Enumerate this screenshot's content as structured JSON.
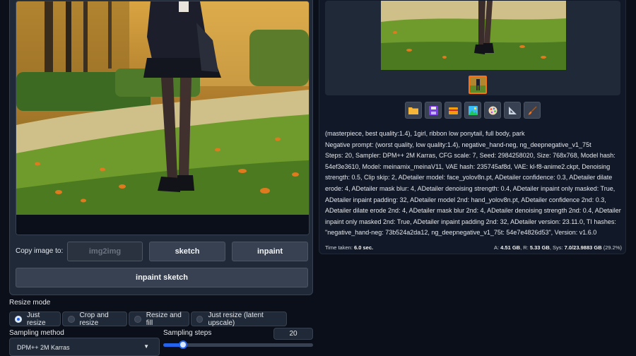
{
  "copy_image": {
    "label": "Copy image to:",
    "buttons": [
      {
        "label": "img2img"
      },
      {
        "label": "sketch"
      },
      {
        "label": "inpaint"
      }
    ]
  },
  "inpaint_sketch_label": "inpaint sketch",
  "resize_mode": {
    "label": "Resize mode",
    "options": [
      {
        "label": "Just resize",
        "checked": true
      },
      {
        "label": "Crop and resize"
      },
      {
        "label": "Resize and fill"
      },
      {
        "label": "Just resize (latent upscale)"
      }
    ]
  },
  "sampling_method": {
    "label": "Sampling method",
    "value": "DPM++ 2M Karras"
  },
  "sampling_steps": {
    "label": "Sampling steps",
    "value": "20",
    "fraction": 0.13
  },
  "toolbar": {
    "icons": [
      "folder-icon",
      "save-icon",
      "zip-icon",
      "send-to-img2img-icon",
      "palette-icon",
      "ruler-triangle-icon",
      "paintbrush-icon"
    ]
  },
  "generation_info": {
    "prompt": "(masterpiece, best quality:1.4), 1girl, ribbon low ponytail, full body, park",
    "negative": "Negative prompt: (worst quality, low quality:1.4), negative_hand-neg, ng_deepnegative_v1_75t",
    "params": "Steps: 20, Sampler: DPM++ 2M Karras, CFG scale: 7, Seed: 2984258020, Size: 768x768, Model hash: 54ef3e3610, Model: meinamix_meinaV11, VAE hash: 235745af8d, VAE: kl-f8-anime2.ckpt, Denoising strength: 0.5, Clip skip: 2, ADetailer model: face_yolov8n.pt, ADetailer confidence: 0.3, ADetailer dilate erode: 4, ADetailer mask blur: 4, ADetailer denoising strength: 0.4, ADetailer inpaint only masked: True, ADetailer inpaint padding: 32, ADetailer model 2nd: hand_yolov8n.pt, ADetailer confidence 2nd: 0.3, ADetailer dilate erode 2nd: 4, ADetailer mask blur 2nd: 4, ADetailer denoising strength 2nd: 0.4, ADetailer inpaint only masked 2nd: True, ADetailer inpaint padding 2nd: 32, ADetailer version: 23.11.0, TI hashes: \"negative_hand-neg: 73b524a2da12, ng_deepnegative_v1_75t: 54e7e4826d53\", Version: v1.6.0"
  },
  "performance": {
    "time_label": "Time taken:",
    "time_value": "6.0 sec.",
    "a_label": "A:",
    "a_value": "4.51 GB",
    "r_label": "R:",
    "r_value": "5.33 GB",
    "sys_label": "Sys:",
    "sys_value": "7.0/23.9883 GB",
    "sys_pct": "(29.2%)"
  },
  "colors": {
    "background": "#0b0f19",
    "panel": "#1f2937",
    "accent": "#2563eb",
    "selected_thumb": "#f97316"
  }
}
